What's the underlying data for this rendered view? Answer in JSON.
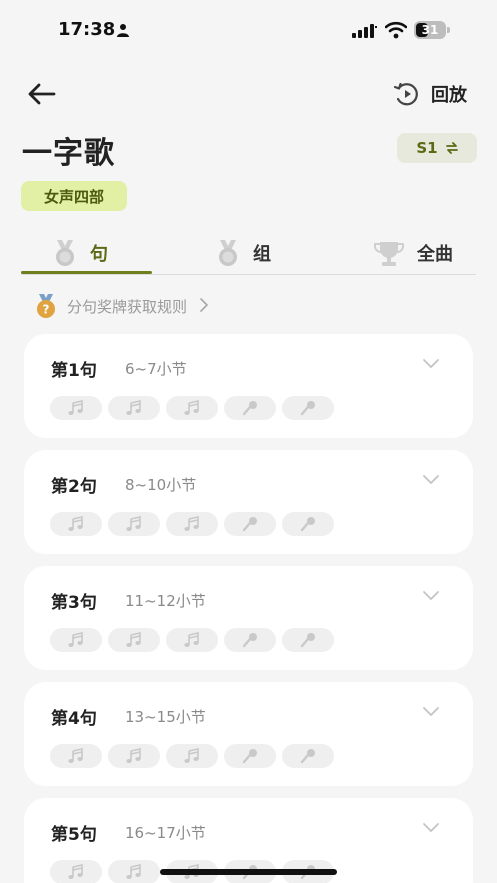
{
  "status_bar": {
    "time": "17:38",
    "battery": "31"
  },
  "nav": {
    "replay_label": "回放"
  },
  "song": {
    "title": "一字歌",
    "season": "S1",
    "voice_part": "女声四部"
  },
  "tabs": [
    {
      "label": "句",
      "icon": "medal-icon",
      "active": true
    },
    {
      "label": "组",
      "icon": "medal-icon",
      "active": false
    },
    {
      "label": "全曲",
      "icon": "trophy-icon",
      "active": false
    }
  ],
  "rules_link": {
    "label": "分句奖牌获取规则",
    "chevron": ">"
  },
  "sentences": [
    {
      "title": "第1句",
      "bars": "6~7小节"
    },
    {
      "title": "第2句",
      "bars": "8~10小节"
    },
    {
      "title": "第3句",
      "bars": "11~12小节"
    },
    {
      "title": "第4句",
      "bars": "13~15小节"
    },
    {
      "title": "第5句",
      "bars": "16~17小节"
    }
  ],
  "pill_icons": [
    "music-note-icon",
    "music-note-icon",
    "music-note-icon",
    "microphone-icon",
    "microphone-icon"
  ],
  "colors": {
    "accent": "#6f7e1c",
    "badge_bg": "#e1f0a4",
    "page_bg": "#f5f5f5"
  }
}
